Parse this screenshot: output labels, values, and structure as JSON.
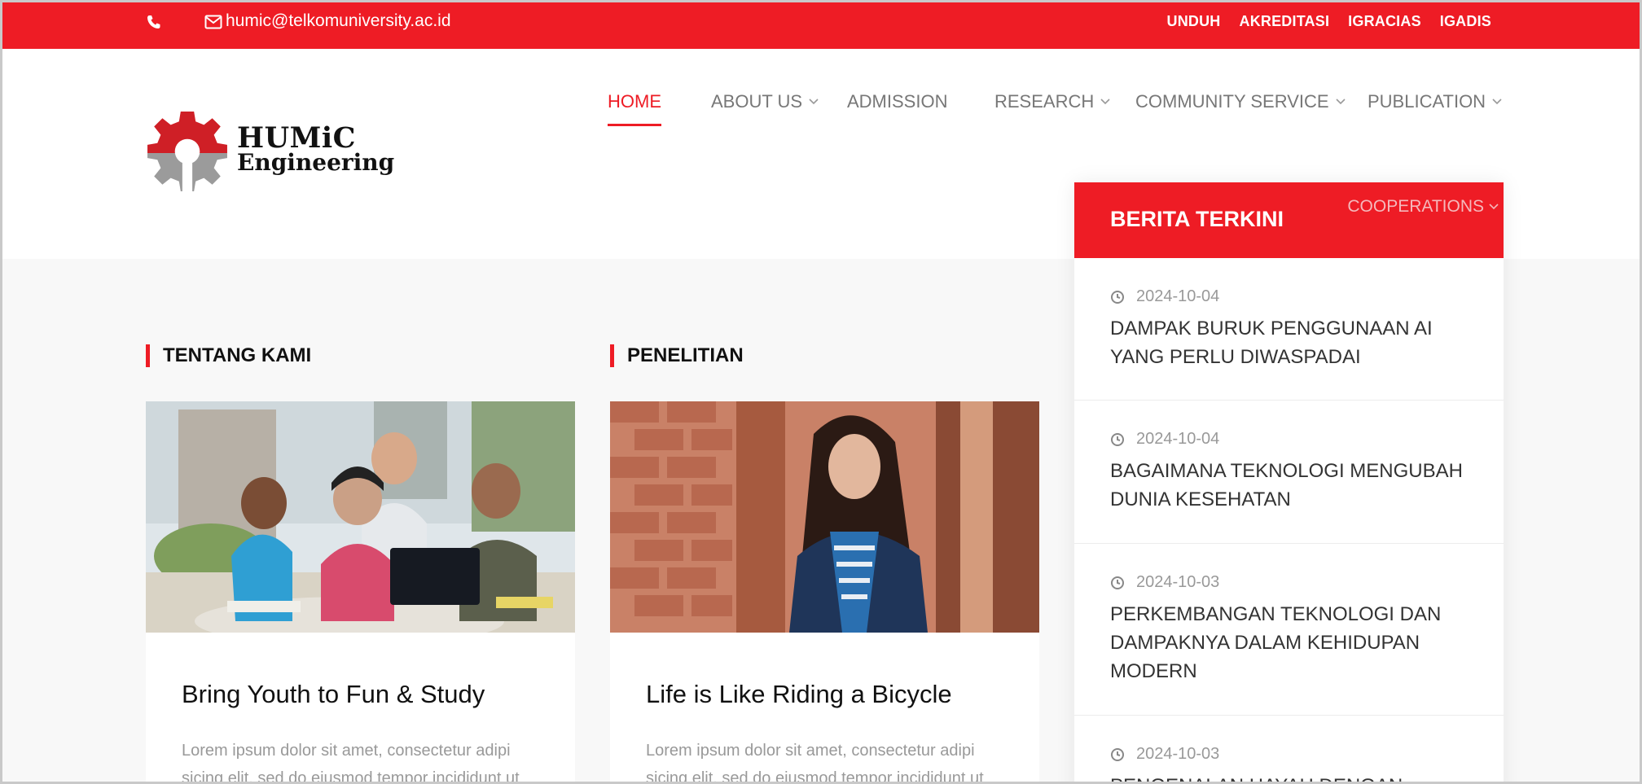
{
  "topbar": {
    "email": "humic@telkomuniversity.ac.id",
    "links": [
      "UNDUH",
      "AKREDITASI",
      "IGRACIAS",
      "IGADIS"
    ]
  },
  "logo": {
    "line1": "HUMiC",
    "line2": "Engineering"
  },
  "nav": [
    {
      "label": "HOME",
      "active": true,
      "dropdown": false
    },
    {
      "label": "ABOUT US",
      "active": false,
      "dropdown": true
    },
    {
      "label": "ADMISSION",
      "active": false,
      "dropdown": false
    },
    {
      "label": "RESEARCH",
      "active": false,
      "dropdown": true
    },
    {
      "label": "COMMUNITY SERVICE",
      "active": false,
      "dropdown": true
    },
    {
      "label": "PUBLICATION",
      "active": false,
      "dropdown": true
    },
    {
      "label": "COOPERATIONS",
      "active": false,
      "dropdown": true
    }
  ],
  "sections": [
    {
      "title": "TENTANG KAMI",
      "card_title": "Bring Youth to Fun & Study",
      "excerpt": "Lorem ipsum dolor sit amet, consectetur adipi sicing elit, sed do eiusmod tempor incididunt ut"
    },
    {
      "title": "PENELITIAN",
      "card_title": "Life is Like Riding a Bicycle",
      "excerpt": "Lorem ipsum dolor sit amet, consectetur adipi sicing elit, sed do eiusmod tempor incididunt ut"
    }
  ],
  "news": {
    "title": "BERITA TERKINI",
    "items": [
      {
        "date": "2024-10-04",
        "headline": "DAMPAK BURUK PENGGUNAAN AI YANG PERLU DIWASPADAI"
      },
      {
        "date": "2024-10-04",
        "headline": "BAGAIMANA TEKNOLOGI MENGUBAH DUNIA KESEHATAN"
      },
      {
        "date": "2024-10-03",
        "headline": "PERKEMBANGAN TEKNOLOGI DAN DAMPAKNYA DALAM KEHIDUPAN MODERN"
      },
      {
        "date": "2024-10-03",
        "headline": "PENGENALAN HAYAH DENGAN"
      }
    ]
  },
  "colors": {
    "accent": "#ee1c25",
    "nav_text": "#777777",
    "muted": "#999999"
  }
}
